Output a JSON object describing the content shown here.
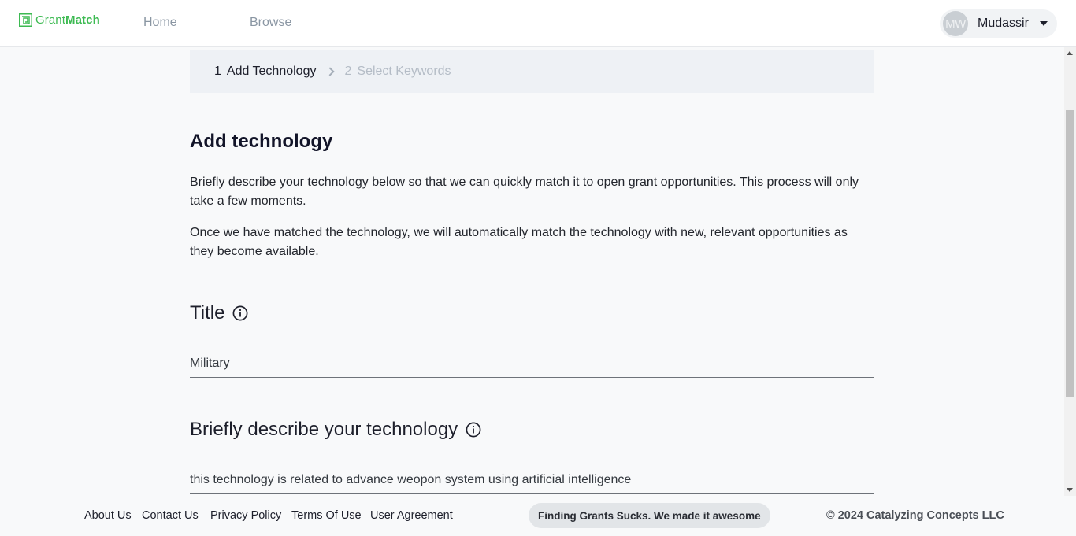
{
  "brand": {
    "name_prefix": "Grant",
    "name_suffix": "Match",
    "color": "#3dba52"
  },
  "nav": {
    "home": "Home",
    "browse": "Browse"
  },
  "user": {
    "initials": "MW",
    "name": "Mudassir"
  },
  "stepper": {
    "steps": [
      {
        "number": "1",
        "label": "Add Technology",
        "state": "active"
      },
      {
        "number": "2",
        "label": "Select Keywords",
        "state": "inactive"
      }
    ]
  },
  "main": {
    "title": "Add technology",
    "intro_1": "Briefly describe your technology below so that we can quickly match it to open grant opportunities. This process will only take a few moments.",
    "intro_2": "Once we have matched the technology, we will automatically match the technology with new, relevant opportunities as they become available.",
    "title_section": {
      "heading": "Title",
      "value": "Military"
    },
    "describe_section": {
      "heading": "Briefly describe your technology",
      "value": "this technology is related to advance weopon system using artificial intelligence"
    }
  },
  "footer": {
    "links": [
      "About Us",
      "Contact Us",
      "Privacy Policy",
      "Terms Of Use",
      "User Agreement"
    ],
    "tagline": "Finding Grants Sucks. We made it awesome",
    "copyright": "© 2024 Catalyzing Concepts LLC"
  },
  "icons": {
    "logo": "grantmatch-logo-icon",
    "info": "info-icon",
    "caret": "caret-down-icon",
    "chevron": "chevron-right-icon"
  }
}
